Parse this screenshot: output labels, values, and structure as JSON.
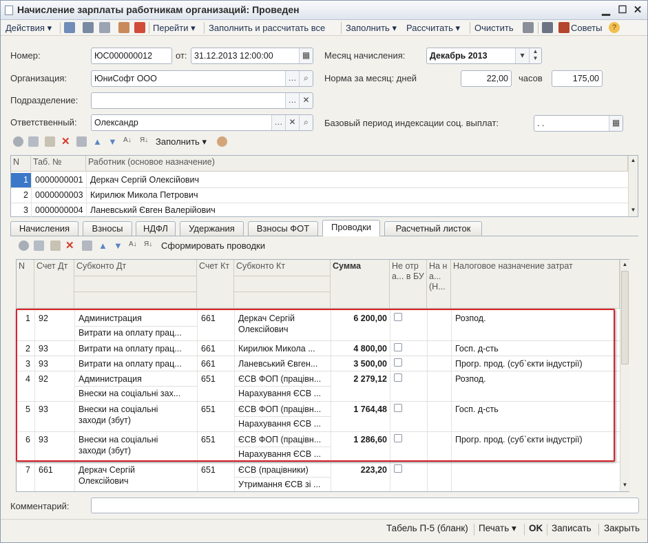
{
  "window": {
    "title": "Начисление зарплаты работникам организаций: Проведен"
  },
  "toolbar": {
    "actions": "Действия",
    "goto": "Перейти",
    "fill_calc_all": "Заполнить и рассчитать все",
    "fill": "Заполнить",
    "calculate": "Рассчитать",
    "clear": "Очистить",
    "tips": "Советы"
  },
  "header": {
    "number_label": "Номер:",
    "number_value": "ЮС000000012",
    "date_label": "от:",
    "date_value": "31.12.2013 12:00:00",
    "org_label": "Организация:",
    "org_value": "ЮниСофт ООО",
    "dept_label": "Подразделение:",
    "dept_value": "",
    "resp_label": "Ответственный:",
    "resp_value": "Олександр",
    "month_label": "Месяц начисления:",
    "month_value": "Декабрь 2013",
    "norm_label": "Норма за месяц: дней",
    "norm_days": "22,00",
    "hours_label": "часов",
    "norm_hours": "175,00",
    "base_period_label": "Базовый период индексации соц. выплат:",
    "base_period_value": ". ."
  },
  "workers_toolbar": {
    "fill": "Заполнить"
  },
  "workers": {
    "columns": [
      "N",
      "Таб. №",
      "Работник (основое назначение)"
    ],
    "rows": [
      {
        "n": "1",
        "tab": "0000000001",
        "name": "Деркач Сергій Олексійович"
      },
      {
        "n": "2",
        "tab": "0000000003",
        "name": "Кирилюк Микола Петрович"
      },
      {
        "n": "3",
        "tab": "0000000004",
        "name": "Ланевський Євген Валерійович"
      }
    ]
  },
  "tabs": [
    "Начисления",
    "Взносы",
    "НДФЛ",
    "Удержания",
    "Взносы ФОТ",
    "Проводки",
    "Расчетный листок"
  ],
  "active_tab": "Проводки",
  "postings_toolbar": {
    "generate": "Сформировать проводки"
  },
  "postings": {
    "columns": {
      "n": "N",
      "dt": "Счет Дт",
      "sub_dt": "Субконто Дт",
      "kt": "Счет Кт",
      "sub_kt": "Субконто Кт",
      "sum": "Сумма",
      "not_bu": "Не отра... в БУ",
      "na": "На на... (Н...",
      "tax": "Налоговое назначение затрат"
    },
    "rows": [
      {
        "n": "1",
        "dt": "92",
        "sub_dt1": "Администрация",
        "sub_dt2": "Витрати на оплату прац...",
        "kt": "661",
        "sub_kt1": "Деркач Сергій",
        "sub_kt2": "Олексійович",
        "sum": "6 200,00",
        "tax": "Розпод."
      },
      {
        "n": "2",
        "dt": "93",
        "sub_dt1": "Витрати на оплату прац...",
        "sub_dt2": "",
        "kt": "661",
        "sub_kt1": "Кирилюк Микола ...",
        "sub_kt2": "",
        "sum": "4 800,00",
        "tax": "Госп. д-сть"
      },
      {
        "n": "3",
        "dt": "93",
        "sub_dt1": "Витрати на оплату прац...",
        "sub_dt2": "",
        "kt": "661",
        "sub_kt1": "Ланевський Євген...",
        "sub_kt2": "",
        "sum": "3 500,00",
        "tax": "Прогр. прод. (суб`єкти індустрії)"
      },
      {
        "n": "4",
        "dt": "92",
        "sub_dt1": "Администрация",
        "sub_dt2": "Внески на соціальні зах...",
        "kt": "651",
        "sub_kt1": "ЄСВ ФОП (працівн...",
        "sub_kt2": "Нарахування ЄСВ ...",
        "sum": "2 279,12",
        "tax": "Розпод."
      },
      {
        "n": "5",
        "dt": "93",
        "sub_dt1": "Внески на соціальні",
        "sub_dt2": "заходи (збут)",
        "kt": "651",
        "sub_kt1": "ЄСВ ФОП (працівн...",
        "sub_kt2": "Нарахування ЄСВ ...",
        "sum": "1 764,48",
        "tax": "Госп. д-сть"
      },
      {
        "n": "6",
        "dt": "93",
        "sub_dt1": "Внески на соціальні",
        "sub_dt2": "заходи (збут)",
        "kt": "651",
        "sub_kt1": "ЄСВ ФОП (працівн...",
        "sub_kt2": "Нарахування ЄСВ ...",
        "sum": "1 286,60",
        "tax": "Прогр. прод. (суб`єкти індустрії)"
      },
      {
        "n": "7",
        "dt": "661",
        "sub_dt1": "Деркач Сергій",
        "sub_dt2": "Олексійович",
        "kt": "651",
        "sub_kt1": "ЄСВ (працівники)",
        "sub_kt2": "Утримання ЄСВ зі ...",
        "sum": "223,20",
        "tax": ""
      }
    ]
  },
  "comment": {
    "label": "Комментарий:",
    "value": ""
  },
  "bottom": {
    "tabel": "Табель П-5 (бланк)",
    "print": "Печать",
    "ok": "OK",
    "save": "Записать",
    "close": "Закрыть"
  },
  "colors": {
    "highlight": "#d6232c",
    "selected_row": "#3b78c8"
  }
}
